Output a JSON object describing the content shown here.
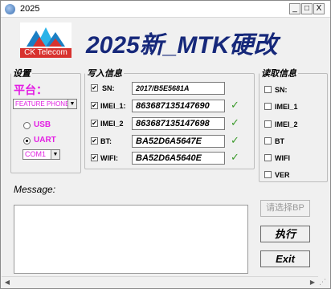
{
  "window": {
    "title": "2025"
  },
  "logo": {
    "text": "CK Telecom"
  },
  "headline": "2025新_MTK硬改",
  "settings": {
    "group_title": "设置",
    "platform_label": "平台：",
    "platform_value": "FEATURE PHONE",
    "radio_usb": "USB",
    "radio_uart": "UART",
    "radio_selected": "UART",
    "com_value": "COM1"
  },
  "write": {
    "group_title": "写入信息",
    "fields": [
      {
        "label": "SN:",
        "value": "2017/B5E5681A",
        "checked": true,
        "ok": false
      },
      {
        "label": "IMEI_1:",
        "value": "863687135147690",
        "checked": true,
        "ok": true
      },
      {
        "label": "IMEI_2",
        "value": "863687135147698",
        "checked": true,
        "ok": true
      },
      {
        "label": "BT:",
        "value": "BA52D6A5647E",
        "checked": true,
        "ok": true
      },
      {
        "label": "WIFI:",
        "value": "BA52D6A5640E",
        "checked": true,
        "ok": true
      }
    ]
  },
  "read": {
    "group_title": "读取信息",
    "items": [
      {
        "label": "SN:"
      },
      {
        "label": "IMEI_1"
      },
      {
        "label": "IMEI_2"
      },
      {
        "label": "BT"
      },
      {
        "label": "WIFI"
      },
      {
        "label": "VER"
      }
    ]
  },
  "message": {
    "label": "Message:"
  },
  "buttons": {
    "select_bp": "请选择BP",
    "execute": "执行",
    "exit": "Exit"
  },
  "symbols": {
    "check_mark": "✔",
    "tick": "✓",
    "radio_dot": "",
    "dropdown": "▼",
    "minimize": "_",
    "maximize": "□",
    "close": "X",
    "scroll_left": "◀",
    "scroll_right": "▶",
    "resize_grip": "⋰"
  },
  "colors": {
    "headline": "#16287a",
    "magenta": "#e41ee4",
    "ok_green": "#3a9a2a",
    "logo_red": "#d8322e"
  }
}
